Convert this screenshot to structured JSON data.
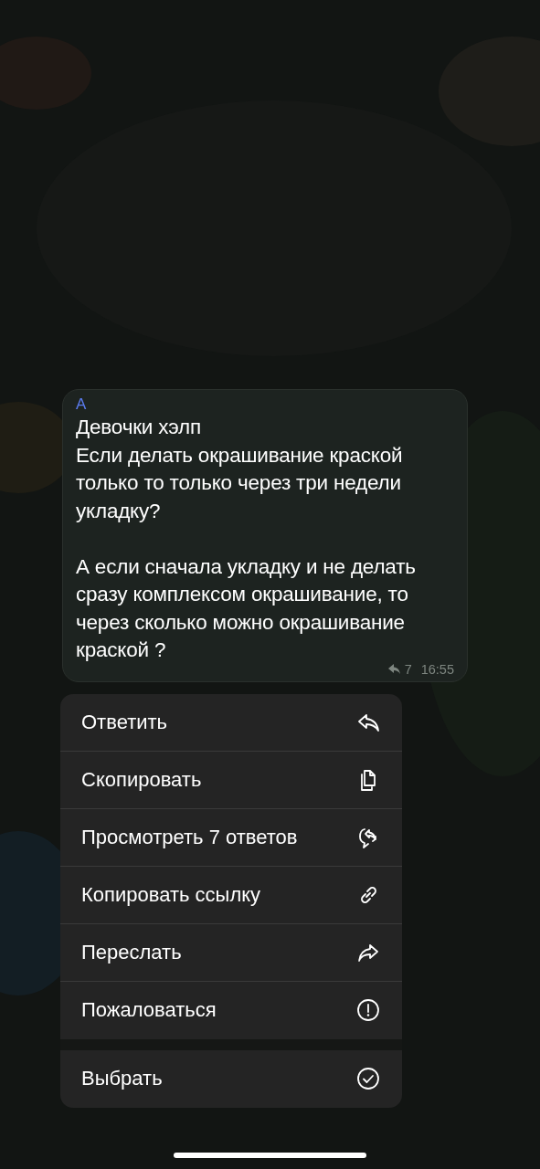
{
  "message": {
    "sender": "A",
    "text": "Девочки хэлп\nЕсли делать окрашивание краской только то только через три недели укладку?\n\nА если сначала укладку и не делать сразу комплексом окрашивание, то через сколько можно окрашивание краской ?",
    "reply_count": "7",
    "time": "16:55"
  },
  "menu": {
    "sections": [
      {
        "items": [
          {
            "label": "Ответить",
            "kind": "reply"
          },
          {
            "label": "Скопировать",
            "kind": "copy"
          },
          {
            "label": "Просмотреть 7 ответов",
            "kind": "replies"
          },
          {
            "label": "Копировать ссылку",
            "kind": "link"
          },
          {
            "label": "Переслать",
            "kind": "forward"
          },
          {
            "label": "Пожаловаться",
            "kind": "report"
          }
        ]
      },
      {
        "items": [
          {
            "label": "Выбрать",
            "kind": "select"
          }
        ]
      }
    ]
  }
}
